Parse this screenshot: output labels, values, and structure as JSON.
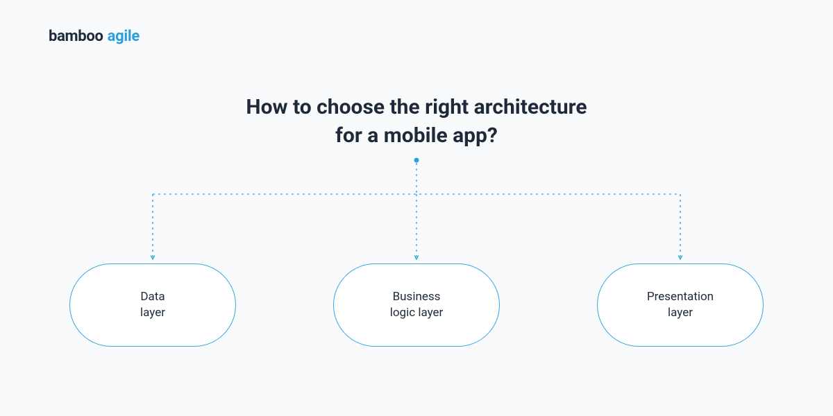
{
  "logo": {
    "word1": "bamboo",
    "word2": "agile"
  },
  "title": {
    "line1": "How to choose the right architecture",
    "line2": "for a mobile app?"
  },
  "nodes": [
    {
      "label": "Data\nlayer"
    },
    {
      "label": "Business\nlogic layer"
    },
    {
      "label": "Presentation\nlayer"
    }
  ],
  "colors": {
    "accent": "#2a9fd8",
    "node_border": "#37a6de",
    "text_dark": "#1e2a3a",
    "bg": "#f8fafc"
  }
}
